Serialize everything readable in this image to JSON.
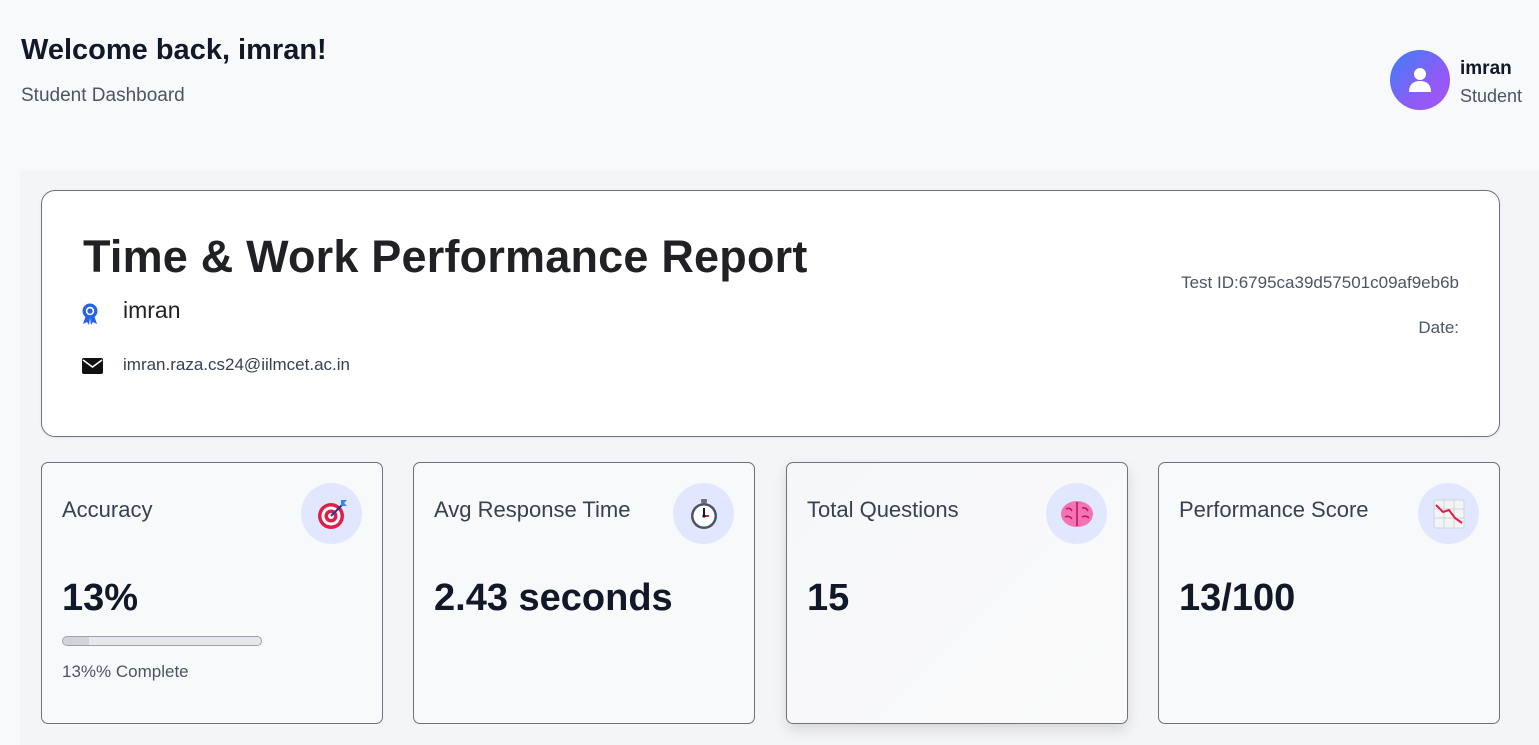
{
  "header": {
    "welcome": "Welcome back, imran!",
    "subtitle": "Student Dashboard"
  },
  "user": {
    "name": "imran",
    "role": "Student",
    "avatar_icon": "user-icon",
    "avatar_gradient": [
      "#3b82f6",
      "#a855f7"
    ]
  },
  "report": {
    "title": "Time & Work Performance Report",
    "name": "imran",
    "email": "imran.raza.cs24@iilmcet.ac.in",
    "test_id": "Test ID:6795ca39d57501c09af9eb6b",
    "date": "Date:",
    "name_icon": "award-icon",
    "email_icon": "envelope-icon"
  },
  "stats": [
    {
      "label": "Accuracy",
      "value": "13%",
      "icon": "target-icon",
      "progress": 0.13,
      "progress_text": "13%% Complete"
    },
    {
      "label": "Avg Response Time",
      "value": "2.43 seconds",
      "icon": "stopwatch-icon"
    },
    {
      "label": "Total Questions",
      "value": "15",
      "icon": "brain-icon"
    },
    {
      "label": "Performance Score",
      "value": "13/100",
      "icon": "chart-decreasing-icon"
    }
  ],
  "colors": {
    "icon_circle": "#e0e7ff",
    "award_icon": "#2563eb"
  }
}
